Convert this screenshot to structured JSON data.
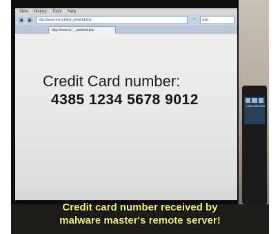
{
  "browser": {
    "menu": [
      "View",
      "History",
      "Tools",
      "Help"
    ],
    "address": "http://www.tom.ct/test_android.php",
    "search_placeholder": "Ask",
    "tab_title": "http://www.to..._android.php"
  },
  "page": {
    "label": "Credit Card number:",
    "number": "4385 1234 5678 9012"
  },
  "phone": {
    "number": "1-888-555-5555"
  },
  "caption": {
    "line1": "Credit card number received by",
    "line2": "malware master's remote server!",
    "color": "#ffff33"
  }
}
